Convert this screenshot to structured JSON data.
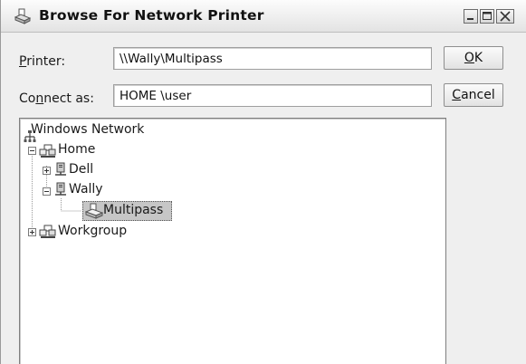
{
  "window": {
    "title": "Browse For Network Printer",
    "title_icon": "printer-icon",
    "controls": [
      "minimize-icon",
      "maximize-icon",
      "close-icon"
    ]
  },
  "form": {
    "printer_label_mnemonic": "P",
    "printer_label_rest": "rinter:",
    "printer_value": "\\\\Wally\\Multipass",
    "connect_label_pre": "Co",
    "connect_label_mnemonic": "n",
    "connect_label_post": "nect as:",
    "connect_value": "HOME \\user"
  },
  "buttons": {
    "ok_mnemonic": "O",
    "ok_rest": "K",
    "cancel_mnemonic": "C",
    "cancel_rest": "ancel"
  },
  "tree": {
    "root": {
      "label": "Windows Network",
      "icon": "network-icon"
    },
    "home": {
      "label": "Home",
      "icon": "workgroup-icon",
      "expanded": true
    },
    "dell": {
      "label": "Dell",
      "icon": "computer-icon",
      "expanded": false
    },
    "wally": {
      "label": "Wally",
      "icon": "computer-icon",
      "expanded": true
    },
    "multipass": {
      "label": "Multipass",
      "icon": "printer-icon",
      "selected": true
    },
    "workgroup": {
      "label": "Workgroup",
      "icon": "workgroup-icon",
      "expanded": false
    }
  }
}
